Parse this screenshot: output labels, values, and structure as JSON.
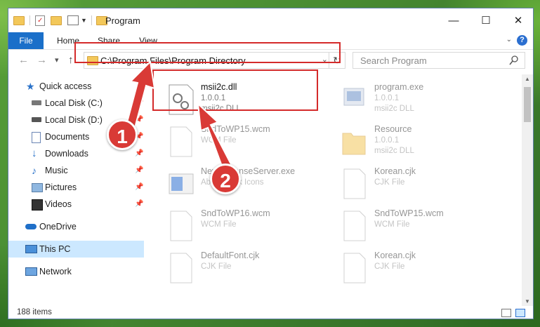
{
  "window": {
    "title": "Program",
    "minimize": "—",
    "maximize": "☐",
    "close": "✕"
  },
  "ribbon": {
    "tabs": [
      "File",
      "Home",
      "Share",
      "View"
    ],
    "help": "?"
  },
  "nav": {
    "back": "←",
    "forward": "→",
    "recent": "▾",
    "up": "↑",
    "address": "C:\\Program Files\\Program Directory",
    "search_placeholder": "Search Program"
  },
  "sidebar": {
    "items": [
      {
        "label": "Quick access",
        "icon": "star-icon"
      },
      {
        "label": "Local Disk (C:)",
        "icon": "drive-icon",
        "pinned": true
      },
      {
        "label": "Local Disk (D:)",
        "icon": "drive-icon",
        "pinned": true
      },
      {
        "label": "Documents",
        "icon": "documents-icon",
        "pinned": true
      },
      {
        "label": "Downloads",
        "icon": "downloads-icon",
        "pinned": true
      },
      {
        "label": "Music",
        "icon": "music-icon",
        "pinned": true
      },
      {
        "label": "Pictures",
        "icon": "pictures-icon",
        "pinned": true
      },
      {
        "label": "Videos",
        "icon": "videos-icon",
        "pinned": true
      },
      {
        "label": "OneDrive",
        "icon": "cloud-icon"
      },
      {
        "label": "This PC",
        "icon": "pc-icon",
        "selected": true
      },
      {
        "label": "Network",
        "icon": "network-icon"
      }
    ]
  },
  "files": [
    {
      "name": "msii2c.dll",
      "line1": "1.0.0.1",
      "line2": "msii2c DLL",
      "icon": "dll-icon"
    },
    {
      "name": "program.exe",
      "line1": "1.0.0.1",
      "line2": "msii2c DLL",
      "icon": "exe-icon"
    },
    {
      "name": "SndToWP15.wcm",
      "line1": "WCM File",
      "line2": "",
      "icon": "file-icon"
    },
    {
      "name": "Resource",
      "line1": "1.0.0.1",
      "line2": "msii2c DLL",
      "icon": "folder-icon"
    },
    {
      "name": "NewsLicenseServer.exe",
      "line1": "Abest Book Icons",
      "line2": "",
      "icon": "exe-icon"
    },
    {
      "name": "Korean.cjk",
      "line1": "CJK File",
      "line2": "",
      "icon": "file-icon"
    },
    {
      "name": "SndToWP16.wcm",
      "line1": "WCM File",
      "line2": "",
      "icon": "file-icon"
    },
    {
      "name": "SndToWP15.wcm",
      "line1": "WCM File",
      "line2": "",
      "icon": "file-icon"
    },
    {
      "name": "DefaultFont.cjk",
      "line1": "CJK File",
      "line2": "",
      "icon": "file-icon"
    },
    {
      "name": "Korean.cjk",
      "line1": "CJK File",
      "line2": "",
      "icon": "file-icon"
    }
  ],
  "status": {
    "count": "188 items"
  },
  "annotations": {
    "step1": "1",
    "step2": "2",
    "color": "#d93a36"
  },
  "colors": {
    "accent": "#1a6fc9",
    "selected": "#cce8ff"
  }
}
